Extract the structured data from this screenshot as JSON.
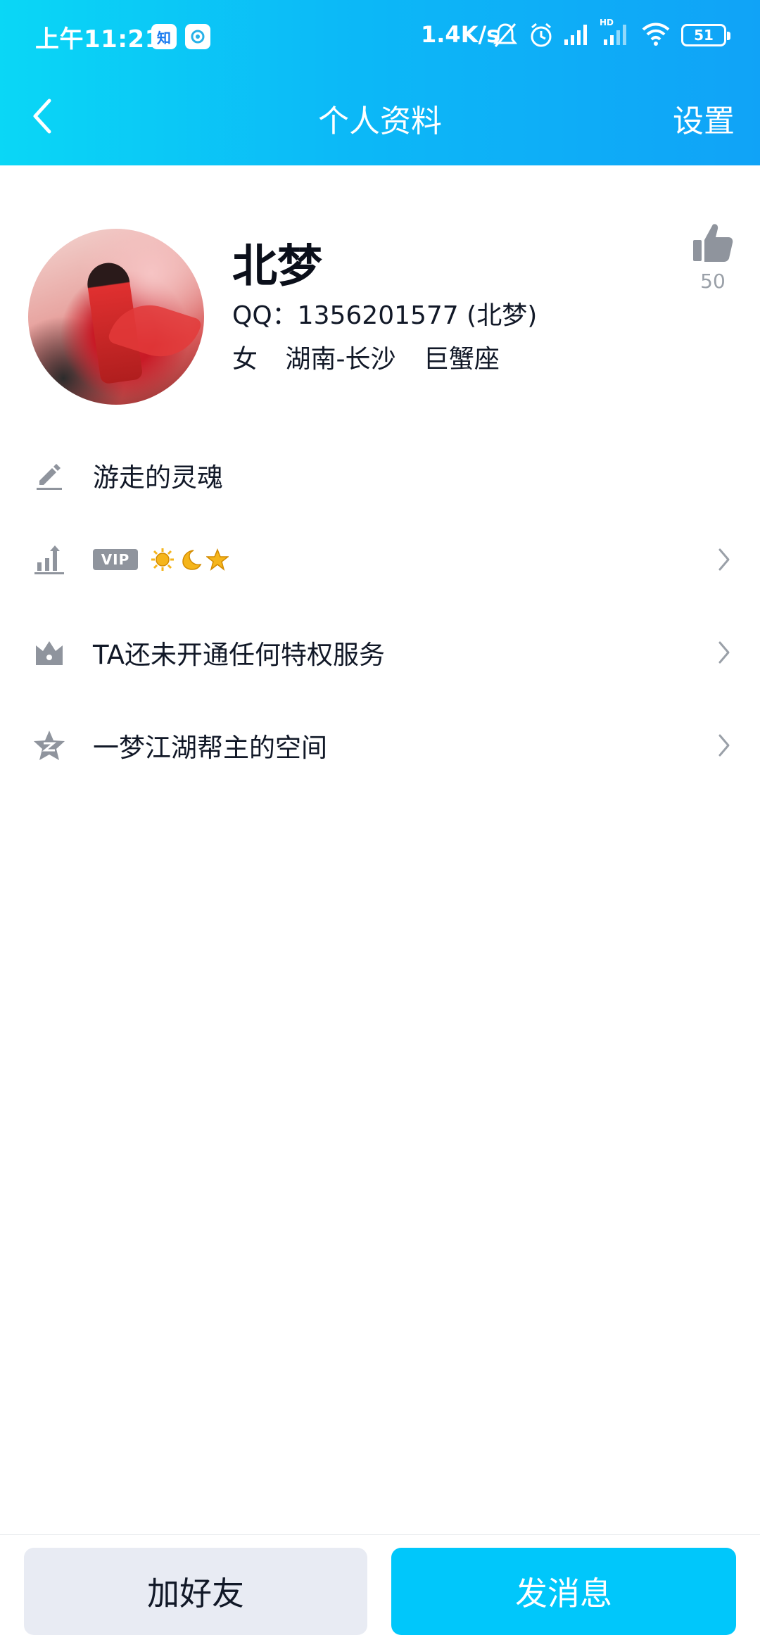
{
  "status_bar": {
    "time": "上午11:21",
    "app_badge_1": "知",
    "net_speed": "1.4K/s",
    "battery": "51",
    "icons": [
      "zhihu-app-icon",
      "app-notification-icon",
      "mute-bell-icon",
      "alarm-icon",
      "signal-icon",
      "hd-signal-icon",
      "wifi-icon",
      "battery-icon"
    ]
  },
  "nav": {
    "title": "个人资料",
    "settings_label": "设置",
    "back_icon": "chevron-left-icon"
  },
  "profile": {
    "name": "北梦",
    "qq_line": "QQ：1356201577 (北梦)",
    "gender": "女",
    "location": "湖南-长沙",
    "zodiac": "巨蟹座",
    "likes": "50",
    "like_icon": "thumb-up-icon"
  },
  "rows": [
    {
      "icon": "edit-pen-icon",
      "text": "游走的灵魂",
      "has_chevron": false
    },
    {
      "icon": "level-up-icon",
      "vip_label": "VIP",
      "level_icons": [
        "sun-icon",
        "moon-icon",
        "star-icon"
      ],
      "has_chevron": true
    },
    {
      "icon": "crown-icon",
      "text": "TA还未开通任何特权服务",
      "has_chevron": true
    },
    {
      "icon": "qzone-star-icon",
      "text": "一梦江湖帮主的空间",
      "has_chevron": true
    }
  ],
  "bottom": {
    "add_friend": "加好友",
    "send_message": "发消息"
  },
  "colors": {
    "header_start": "#0ad7f6",
    "header_end": "#10a3f7",
    "primary_button": "#00c7fb",
    "secondary_button": "#e8ebf3",
    "icon_gray": "#8f949d"
  }
}
